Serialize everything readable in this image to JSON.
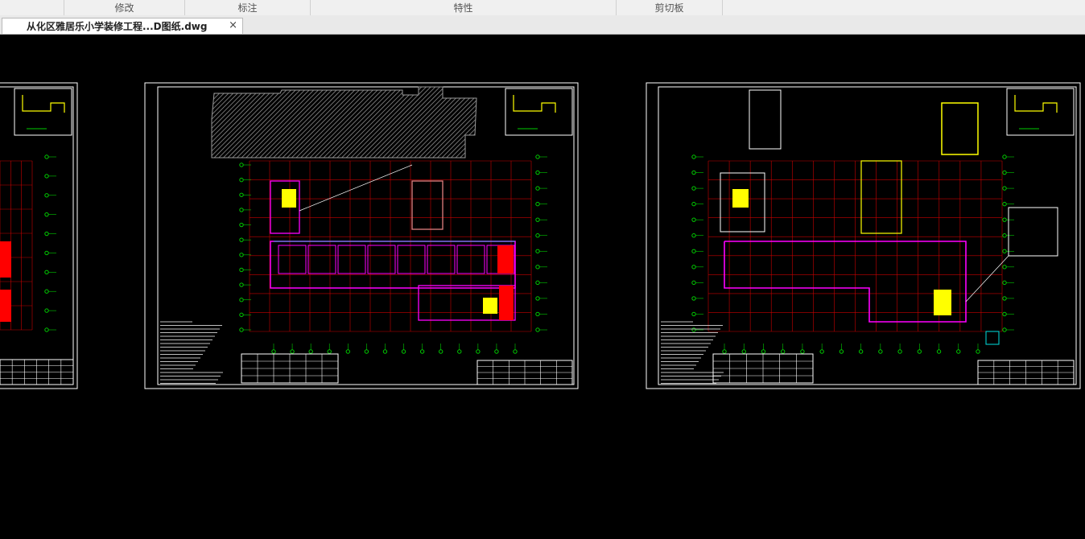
{
  "ribbon": {
    "panels": [
      "",
      "修改",
      "标注",
      "特性",
      "剪切板",
      ""
    ]
  },
  "tabs": {
    "active_title": "从化区雅居乐小学装修工程...D图纸.dwg",
    "close_glyph": "×"
  },
  "canvas": {
    "background": "#000000",
    "sheet_count": 3,
    "colors": {
      "frame": "#ffffff",
      "grid": "#c80000",
      "dims": "#00cc00",
      "walls": "#ff00ff",
      "fill_red": "#ff0000",
      "fill_yellow": "#ffff00",
      "hatch": "#9a9a9a",
      "cyan": "#00e0e0"
    }
  }
}
